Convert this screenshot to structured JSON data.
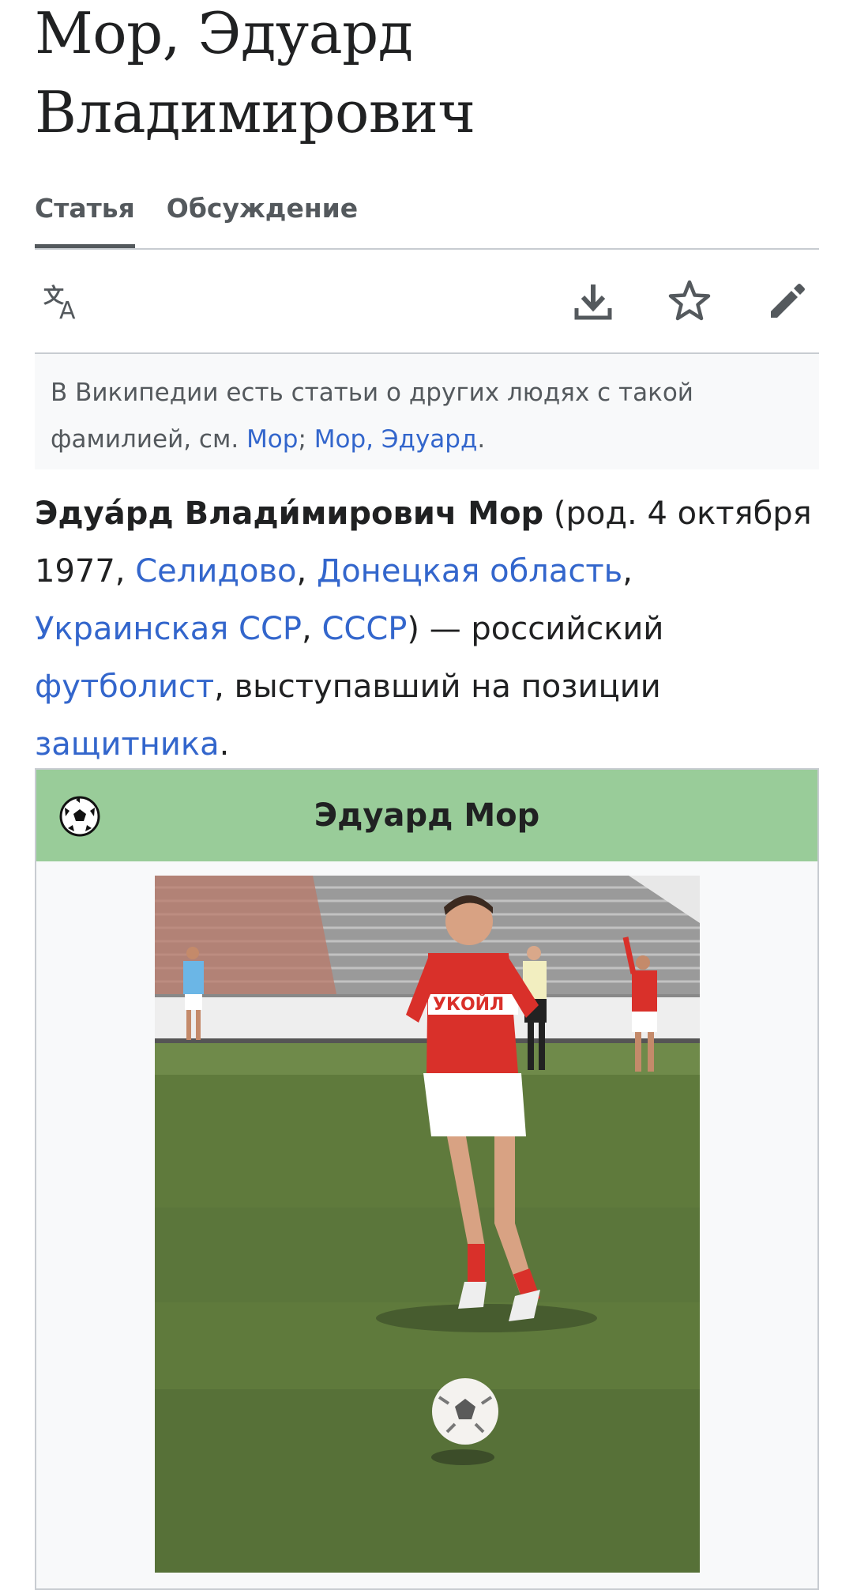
{
  "article": {
    "title": "Мор, Эдуард Владимирович"
  },
  "tabs": [
    {
      "label": "Статья",
      "active": true
    },
    {
      "label": "Обсуждение",
      "active": false
    }
  ],
  "toolbar": {
    "icons": [
      "language-icon",
      "download-icon",
      "star-icon",
      "edit-pencil-icon"
    ]
  },
  "hatnote": {
    "text_before": "В Википедии есть статьи о других людях с такой фамилией, см. ",
    "link1": "Мор",
    "separator": "; ",
    "link2": "Мор, Эдуард",
    "text_after": "."
  },
  "lead": {
    "bold_name": "Эдуа́рд Влади́мирович Мор",
    "t1": " (род. 4 октября 1977, ",
    "link_selidovo": "Селидово",
    "t2": ", ",
    "link_donetsk": "Донецкая область",
    "t3": ", ",
    "link_ukr_ssr": "Украинская ССР",
    "t4": ", ",
    "link_ussr": "СССР",
    "t5": ") — российский ",
    "link_footballer": "футболист",
    "t6": ", выступавший на позиции ",
    "link_defender": "защитника",
    "t7": "."
  },
  "infobox": {
    "title": "Эдуард Мор",
    "header_color": "#99cc99",
    "sport_icon": "football-icon",
    "photo_text": "УКОЙЛ"
  },
  "colors": {
    "link": "#3366cc",
    "text": "#202122",
    "muted": "#54595d",
    "border": "#c8ccd1"
  }
}
